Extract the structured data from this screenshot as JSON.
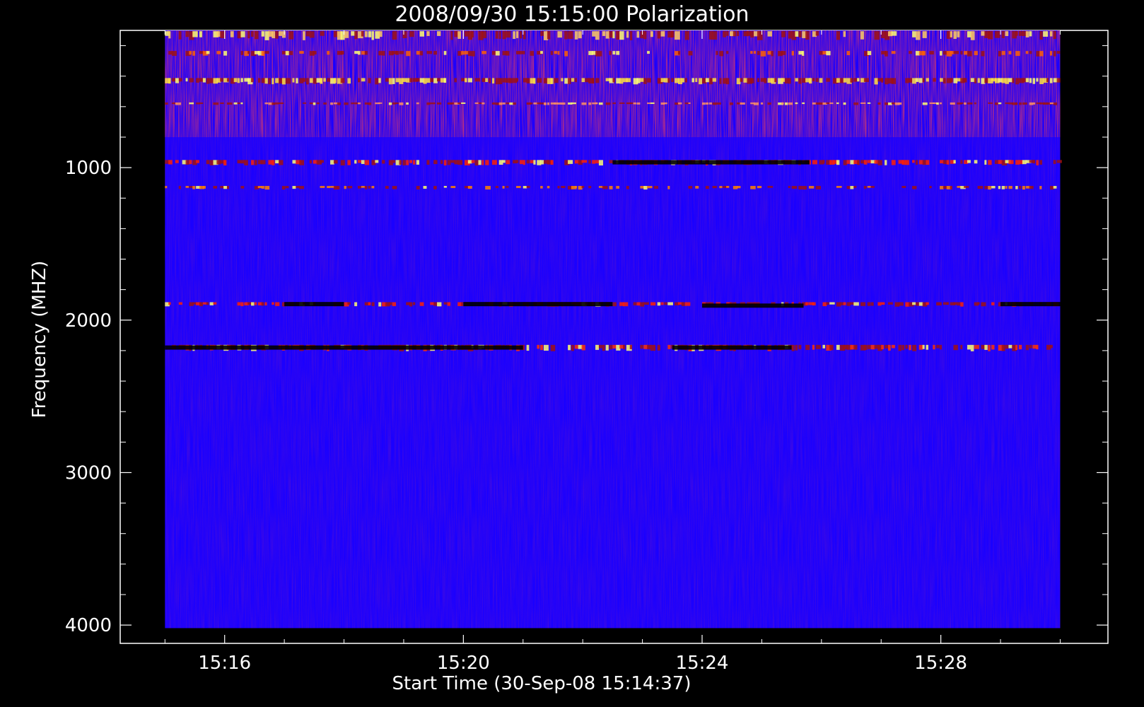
{
  "chart_data": {
    "type": "heatmap",
    "title": "2008/09/30 15:15:00 Polarization",
    "xlabel": "Start Time (30-Sep-08 15:14:37)",
    "ylabel": "Frequency (MHZ)",
    "x_ticks": [
      {
        "label": "15:16",
        "minutes": 16
      },
      {
        "label": "15:20",
        "minutes": 20
      },
      {
        "label": "15:24",
        "minutes": 24
      },
      {
        "label": "15:28",
        "minutes": 28
      }
    ],
    "y_ticks": [
      1000,
      2000,
      3000,
      4000
    ],
    "xlim_minutes": [
      14.25,
      30.8
    ],
    "ylim": [
      100,
      4120
    ],
    "data_extent": {
      "x_minutes": [
        15.0,
        30.0
      ],
      "y_mhz": [
        100,
        4020
      ]
    },
    "colormap": [
      "#000000",
      "#1a00ff",
      "#cc1010",
      "#ff8020",
      "#ffff60"
    ],
    "background_color": "#1a00ff",
    "bands": [
      {
        "freq_mhz": 130,
        "width_mhz": 50,
        "color": "#ffcc60",
        "intensity": 0.55
      },
      {
        "freq_mhz": 250,
        "width_mhz": 30,
        "color": "#ff6000",
        "intensity": 0.5
      },
      {
        "freq_mhz": 430,
        "width_mhz": 35,
        "color": "#ffe040",
        "intensity": 0.85
      },
      {
        "freq_mhz": 580,
        "width_mhz": 15,
        "color": "#ff9060",
        "intensity": 0.6
      },
      {
        "freq_mhz": 965,
        "width_mhz": 30,
        "color": "#ff2000",
        "intensity": 0.75
      },
      {
        "freq_mhz": 1130,
        "width_mhz": 20,
        "color": "#ff8000",
        "intensity": 0.45
      },
      {
        "freq_mhz": 1895,
        "width_mhz": 25,
        "color": "#ff2000",
        "intensity": 0.6
      },
      {
        "freq_mhz": 2180,
        "width_mhz": 35,
        "color": "#ff3000",
        "intensity": 0.75
      }
    ],
    "dark_segments": [
      {
        "freq_mhz": 965,
        "x_minutes": [
          22.5,
          25.8
        ]
      },
      {
        "freq_mhz": 1895,
        "x_minutes": [
          17.0,
          18.0
        ]
      },
      {
        "freq_mhz": 1895,
        "x_minutes": [
          20.0,
          22.5
        ]
      },
      {
        "freq_mhz": 1905,
        "x_minutes": [
          24.0,
          25.7
        ]
      },
      {
        "freq_mhz": 1895,
        "x_minutes": [
          29.0,
          30.0
        ]
      },
      {
        "freq_mhz": 2180,
        "x_minutes": [
          15.0,
          21.0
        ]
      },
      {
        "freq_mhz": 2180,
        "x_minutes": [
          23.5,
          25.5
        ]
      }
    ]
  }
}
